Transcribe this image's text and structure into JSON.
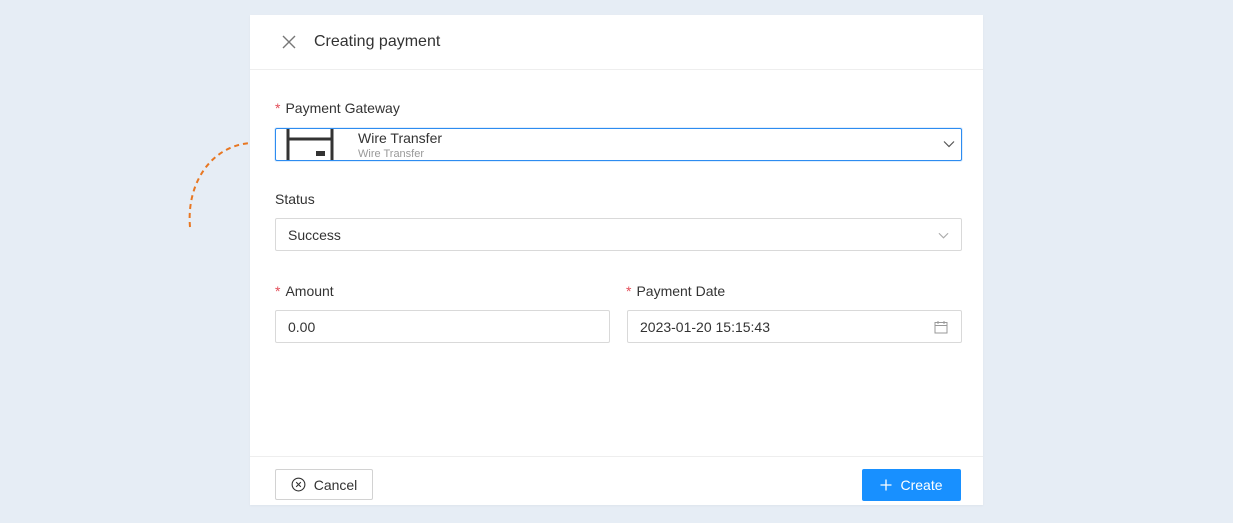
{
  "modal": {
    "title": "Creating payment"
  },
  "form": {
    "gateway": {
      "label": "Payment Gateway",
      "required_mark": "*",
      "selected_name": "Wire Transfer",
      "selected_sub": "Wire Transfer",
      "icon": "wire-transfer-icon"
    },
    "status": {
      "label": "Status",
      "value": "Success"
    },
    "amount": {
      "label": "Amount",
      "required_mark": "*",
      "value": "0.00"
    },
    "payment_date": {
      "label": "Payment Date",
      "required_mark": "*",
      "value": "2023-01-20 15:15:43"
    }
  },
  "footer": {
    "cancel_label": "Cancel",
    "create_label": "Create"
  },
  "colors": {
    "page_bg": "#e6edf5",
    "primary": "#1890ff",
    "required": "#e34d59",
    "annotation_arrow": "#e87722"
  }
}
